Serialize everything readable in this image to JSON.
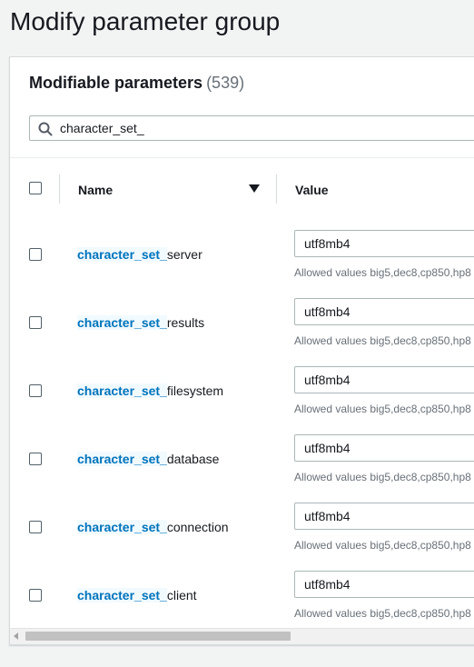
{
  "page": {
    "title": "Modify parameter group"
  },
  "panel": {
    "title": "Modifiable parameters",
    "count": "(539)"
  },
  "search": {
    "icon": "search-icon",
    "value": "character_set_"
  },
  "table": {
    "columns": {
      "name": "Name",
      "value": "Value"
    },
    "rows": [
      {
        "match": "character_set_",
        "rest": "server",
        "value": "utf8mb4",
        "allowed": "Allowed values big5,dec8,cp850,hp8"
      },
      {
        "match": "character_set_",
        "rest": "results",
        "value": "utf8mb4",
        "allowed": "Allowed values big5,dec8,cp850,hp8"
      },
      {
        "match": "character_set_",
        "rest": "filesystem",
        "value": "utf8mb4",
        "allowed": "Allowed values big5,dec8,cp850,hp8"
      },
      {
        "match": "character_set_",
        "rest": "database",
        "value": "utf8mb4",
        "allowed": "Allowed values big5,dec8,cp850,hp8"
      },
      {
        "match": "character_set_",
        "rest": "connection",
        "value": "utf8mb4",
        "allowed": "Allowed values big5,dec8,cp850,hp8"
      },
      {
        "match": "character_set_",
        "rest": "client",
        "value": "utf8mb4",
        "allowed": "Allowed values big5,dec8,cp850,hp8"
      }
    ]
  },
  "colors": {
    "link": "#0073bb",
    "text": "#16191f",
    "muted": "#687078",
    "border": "#aab7b8",
    "background": "#f2f3f3"
  }
}
